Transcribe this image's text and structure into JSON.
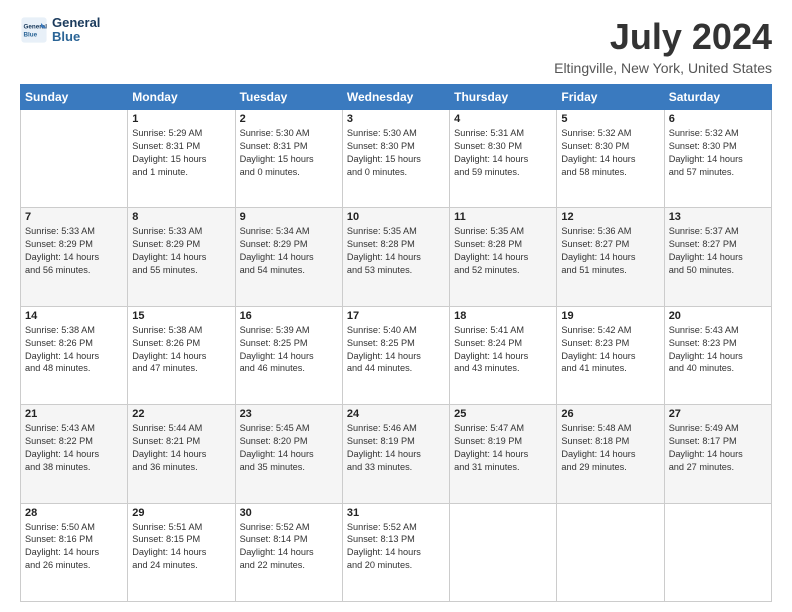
{
  "logo": {
    "line1": "General",
    "line2": "Blue"
  },
  "title": "July 2024",
  "subtitle": "Eltingville, New York, United States",
  "days_of_week": [
    "Sunday",
    "Monday",
    "Tuesday",
    "Wednesday",
    "Thursday",
    "Friday",
    "Saturday"
  ],
  "weeks": [
    [
      {
        "day": "",
        "info": ""
      },
      {
        "day": "1",
        "info": "Sunrise: 5:29 AM\nSunset: 8:31 PM\nDaylight: 15 hours\nand 1 minute."
      },
      {
        "day": "2",
        "info": "Sunrise: 5:30 AM\nSunset: 8:31 PM\nDaylight: 15 hours\nand 0 minutes."
      },
      {
        "day": "3",
        "info": "Sunrise: 5:30 AM\nSunset: 8:30 PM\nDaylight: 15 hours\nand 0 minutes."
      },
      {
        "day": "4",
        "info": "Sunrise: 5:31 AM\nSunset: 8:30 PM\nDaylight: 14 hours\nand 59 minutes."
      },
      {
        "day": "5",
        "info": "Sunrise: 5:32 AM\nSunset: 8:30 PM\nDaylight: 14 hours\nand 58 minutes."
      },
      {
        "day": "6",
        "info": "Sunrise: 5:32 AM\nSunset: 8:30 PM\nDaylight: 14 hours\nand 57 minutes."
      }
    ],
    [
      {
        "day": "7",
        "info": "Sunrise: 5:33 AM\nSunset: 8:29 PM\nDaylight: 14 hours\nand 56 minutes."
      },
      {
        "day": "8",
        "info": "Sunrise: 5:33 AM\nSunset: 8:29 PM\nDaylight: 14 hours\nand 55 minutes."
      },
      {
        "day": "9",
        "info": "Sunrise: 5:34 AM\nSunset: 8:29 PM\nDaylight: 14 hours\nand 54 minutes."
      },
      {
        "day": "10",
        "info": "Sunrise: 5:35 AM\nSunset: 8:28 PM\nDaylight: 14 hours\nand 53 minutes."
      },
      {
        "day": "11",
        "info": "Sunrise: 5:35 AM\nSunset: 8:28 PM\nDaylight: 14 hours\nand 52 minutes."
      },
      {
        "day": "12",
        "info": "Sunrise: 5:36 AM\nSunset: 8:27 PM\nDaylight: 14 hours\nand 51 minutes."
      },
      {
        "day": "13",
        "info": "Sunrise: 5:37 AM\nSunset: 8:27 PM\nDaylight: 14 hours\nand 50 minutes."
      }
    ],
    [
      {
        "day": "14",
        "info": "Sunrise: 5:38 AM\nSunset: 8:26 PM\nDaylight: 14 hours\nand 48 minutes."
      },
      {
        "day": "15",
        "info": "Sunrise: 5:38 AM\nSunset: 8:26 PM\nDaylight: 14 hours\nand 47 minutes."
      },
      {
        "day": "16",
        "info": "Sunrise: 5:39 AM\nSunset: 8:25 PM\nDaylight: 14 hours\nand 46 minutes."
      },
      {
        "day": "17",
        "info": "Sunrise: 5:40 AM\nSunset: 8:25 PM\nDaylight: 14 hours\nand 44 minutes."
      },
      {
        "day": "18",
        "info": "Sunrise: 5:41 AM\nSunset: 8:24 PM\nDaylight: 14 hours\nand 43 minutes."
      },
      {
        "day": "19",
        "info": "Sunrise: 5:42 AM\nSunset: 8:23 PM\nDaylight: 14 hours\nand 41 minutes."
      },
      {
        "day": "20",
        "info": "Sunrise: 5:43 AM\nSunset: 8:23 PM\nDaylight: 14 hours\nand 40 minutes."
      }
    ],
    [
      {
        "day": "21",
        "info": "Sunrise: 5:43 AM\nSunset: 8:22 PM\nDaylight: 14 hours\nand 38 minutes."
      },
      {
        "day": "22",
        "info": "Sunrise: 5:44 AM\nSunset: 8:21 PM\nDaylight: 14 hours\nand 36 minutes."
      },
      {
        "day": "23",
        "info": "Sunrise: 5:45 AM\nSunset: 8:20 PM\nDaylight: 14 hours\nand 35 minutes."
      },
      {
        "day": "24",
        "info": "Sunrise: 5:46 AM\nSunset: 8:19 PM\nDaylight: 14 hours\nand 33 minutes."
      },
      {
        "day": "25",
        "info": "Sunrise: 5:47 AM\nSunset: 8:19 PM\nDaylight: 14 hours\nand 31 minutes."
      },
      {
        "day": "26",
        "info": "Sunrise: 5:48 AM\nSunset: 8:18 PM\nDaylight: 14 hours\nand 29 minutes."
      },
      {
        "day": "27",
        "info": "Sunrise: 5:49 AM\nSunset: 8:17 PM\nDaylight: 14 hours\nand 27 minutes."
      }
    ],
    [
      {
        "day": "28",
        "info": "Sunrise: 5:50 AM\nSunset: 8:16 PM\nDaylight: 14 hours\nand 26 minutes."
      },
      {
        "day": "29",
        "info": "Sunrise: 5:51 AM\nSunset: 8:15 PM\nDaylight: 14 hours\nand 24 minutes."
      },
      {
        "day": "30",
        "info": "Sunrise: 5:52 AM\nSunset: 8:14 PM\nDaylight: 14 hours\nand 22 minutes."
      },
      {
        "day": "31",
        "info": "Sunrise: 5:52 AM\nSunset: 8:13 PM\nDaylight: 14 hours\nand 20 minutes."
      },
      {
        "day": "",
        "info": ""
      },
      {
        "day": "",
        "info": ""
      },
      {
        "day": "",
        "info": ""
      }
    ]
  ],
  "colors": {
    "header_bg": "#3a7abf",
    "row_even": "#f5f5f5",
    "row_odd": "#ffffff"
  }
}
